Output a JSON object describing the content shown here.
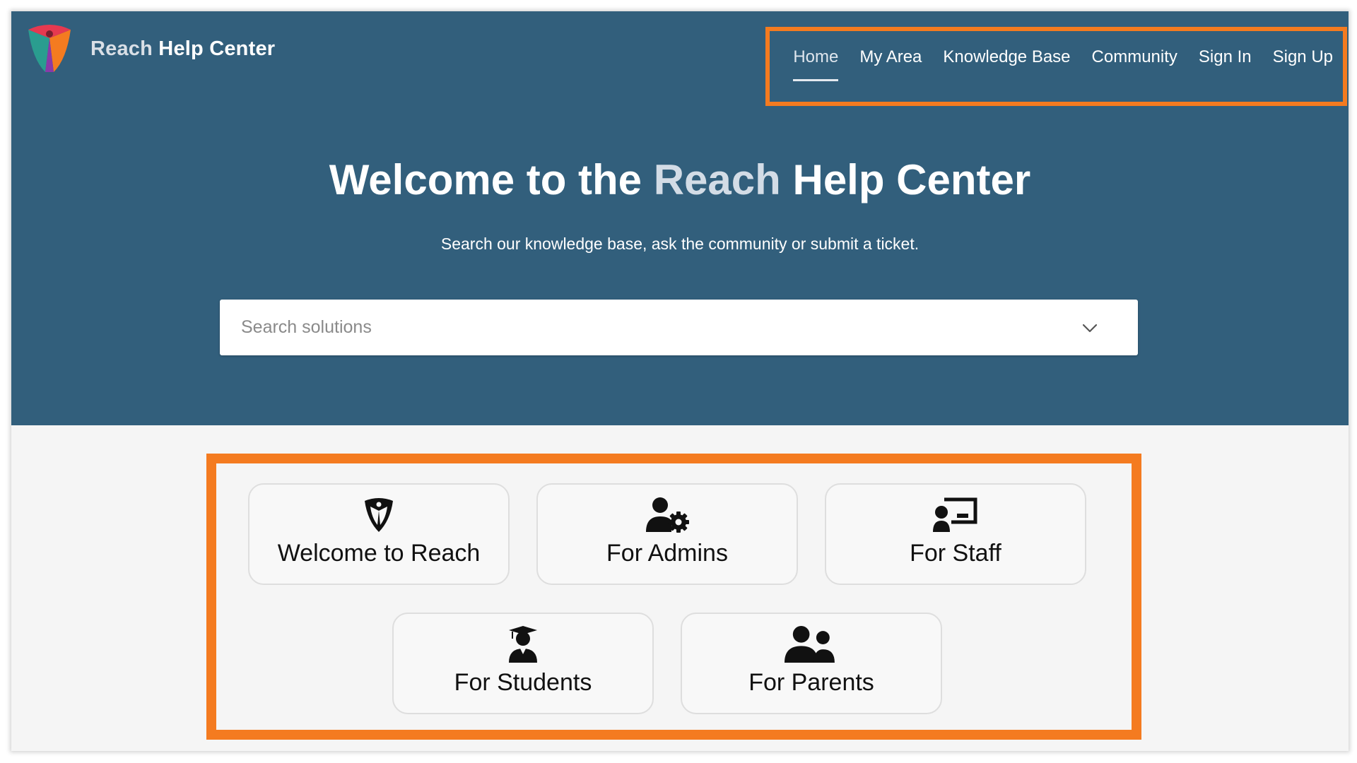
{
  "header": {
    "brand": {
      "accent": "Reach",
      "rest": " Help Center"
    },
    "logo_icon": "reach-logo-icon"
  },
  "nav": {
    "items": [
      {
        "label": "Home",
        "active": true
      },
      {
        "label": "My Area",
        "active": false
      },
      {
        "label": "Knowledge Base",
        "active": false
      },
      {
        "label": "Community",
        "active": false
      },
      {
        "label": "Sign In",
        "active": false
      },
      {
        "label": "Sign Up",
        "active": false
      }
    ]
  },
  "hero": {
    "title_before": "Welcome to the ",
    "title_accent": "Reach",
    "title_after": " Help Center",
    "subtitle": "Search our knowledge base, ask the community or submit a ticket."
  },
  "search": {
    "placeholder": "Search solutions",
    "value": "",
    "dropdown_icon": "chevron-down-icon"
  },
  "cards": [
    {
      "label": "Welcome to Reach",
      "icon": "reach-shield-icon"
    },
    {
      "label": "For Admins",
      "icon": "user-gear-icon"
    },
    {
      "label": "For Staff",
      "icon": "teacher-board-icon"
    },
    {
      "label": "For Students",
      "icon": "student-graduate-icon"
    },
    {
      "label": "For Parents",
      "icon": "users-icon"
    }
  ],
  "colors": {
    "hero_background": "#325f7c",
    "highlight_orange": "#f47b20",
    "page_background": "#f5f5f5"
  }
}
